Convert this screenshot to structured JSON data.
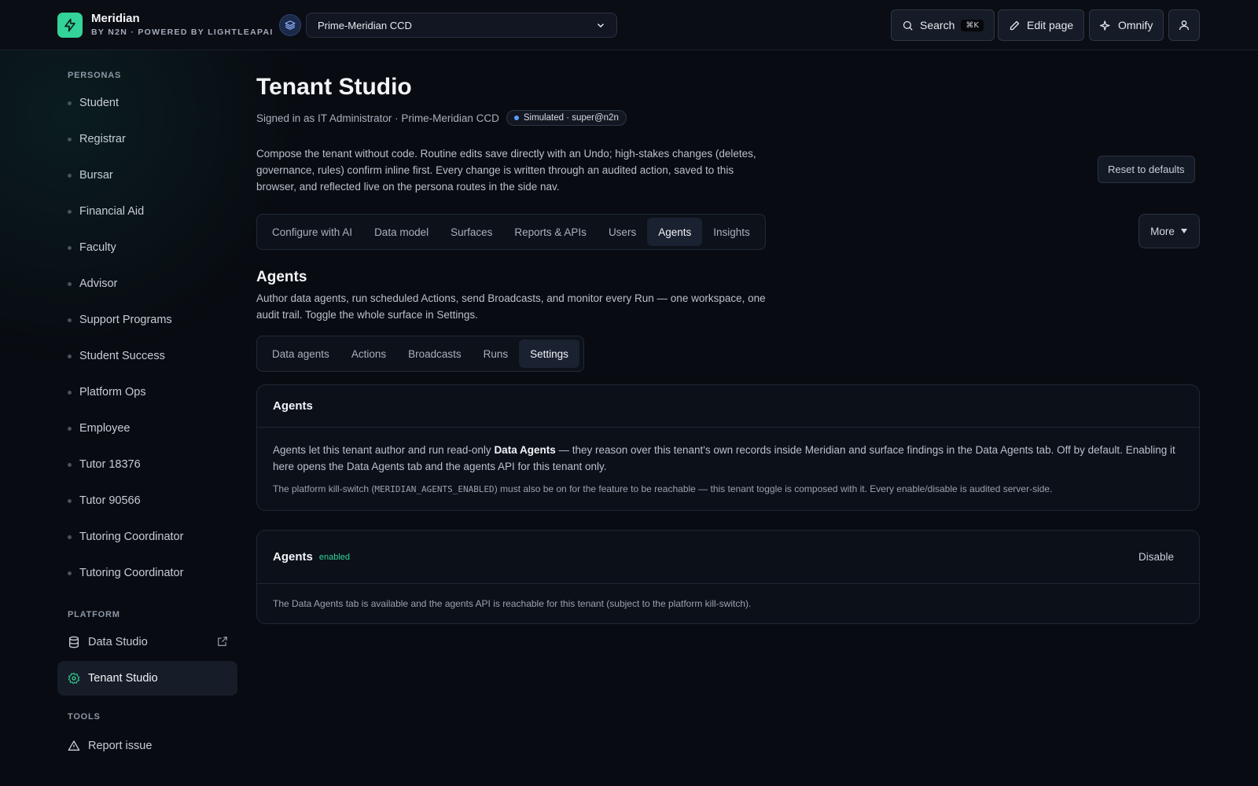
{
  "brand": {
    "name": "Meridian",
    "subtitle": "BY N2N · POWERED BY LIGHTLEAPAI",
    "accent": "#34d399"
  },
  "tenant_select": {
    "value": "Prime-Meridian CCD"
  },
  "topbar": {
    "search_label": "Search",
    "search_shortcut": "⌘K",
    "edit_label": "Edit page",
    "omnify_label": "Omnify"
  },
  "sidebar": {
    "personas_label": "PERSONAS",
    "personas": [
      "Student",
      "Registrar",
      "Bursar",
      "Financial Aid",
      "Faculty",
      "Advisor",
      "Support Programs",
      "Student Success",
      "Platform Ops",
      "Employee",
      "Tutor 18376",
      "Tutor 90566",
      "Tutoring Coordinator",
      "Tutoring Coordinator"
    ],
    "platform_label": "PLATFORM",
    "platform_items": [
      "Data Studio",
      "Tenant Studio"
    ],
    "tools_label": "TOOLS",
    "tools_items": [
      "Report issue"
    ]
  },
  "page": {
    "title": "Tenant Studio",
    "signed_in": "Signed in as IT Administrator · Prime-Meridian CCD",
    "badge": "Simulated · super@n2n",
    "intro": "Compose the tenant without code. Routine edits save directly with an Undo; high-stakes changes (deletes, governance, rules) confirm inline first. Every change is written through an audited action, saved to this browser, and reflected live on the persona routes in the side nav.",
    "reset_label": "Reset to defaults",
    "tabs": [
      "Configure with AI",
      "Data model",
      "Surfaces",
      "Reports & APIs",
      "Users",
      "Agents",
      "Insights"
    ],
    "active_tab": "Agents",
    "more_label": "More"
  },
  "agents_section": {
    "title": "Agents",
    "desc": "Author data agents, run scheduled Actions, send Broadcasts, and monitor every Run — one workspace, one audit trail. Toggle the whole surface in Settings.",
    "subtabs": [
      "Data agents",
      "Actions",
      "Broadcasts",
      "Runs",
      "Settings"
    ],
    "active_subtab": "Settings"
  },
  "info_card": {
    "title": "Agents",
    "p1_before": "Agents let this tenant author and run read-only ",
    "p1_strong": "Data Agents",
    "p1_after": " — they reason over this tenant's own records inside Meridian and surface findings in the Data Agents tab. Off by default. Enabling it here opens the Data Agents tab and the agents API for this tenant only.",
    "p2_before": "The platform kill-switch (",
    "p2_code": "MERIDIAN_AGENTS_ENABLED",
    "p2_after": ") must also be on for the feature to be reachable — this tenant toggle is composed with it. Every enable/disable is audited server-side."
  },
  "toggle_card": {
    "title": "Agents",
    "status": "enabled",
    "button": "Disable",
    "note": "The Data Agents tab is available and the agents API is reachable for this tenant (subject to the platform kill-switch)."
  }
}
